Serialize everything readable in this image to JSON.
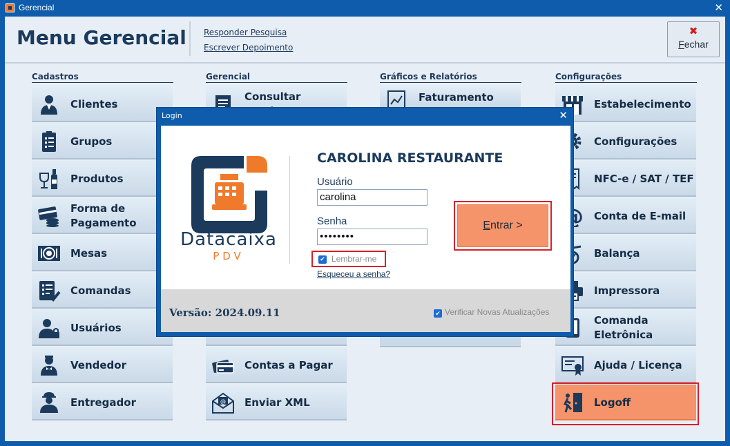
{
  "window": {
    "title": "Gerencial",
    "close_glyph": "✕"
  },
  "header": {
    "title": "Menu Gerencial",
    "links": [
      "Responder Pesquisa",
      "Escrever Depoimento"
    ],
    "close_button": {
      "icon": "close-x-icon",
      "label_first": "F",
      "label_rest": "echar"
    }
  },
  "columns": [
    {
      "title": "Cadastros",
      "items": [
        {
          "label": "Clientes",
          "icon": "person-icon"
        },
        {
          "label": "Grupos",
          "icon": "clipboard-list-icon"
        },
        {
          "label": "Produtos",
          "icon": "wine-bottle-icon"
        },
        {
          "label": "Forma de Pagamento",
          "icon": "card-coins-icon"
        },
        {
          "label": "Mesas",
          "icon": "plate-cutlery-icon"
        },
        {
          "label": "Comandas",
          "icon": "checklist-icon"
        },
        {
          "label": "Usuários",
          "icon": "user-lock-icon"
        },
        {
          "label": "Vendedor",
          "icon": "waiter-icon"
        },
        {
          "label": "Entregador",
          "icon": "delivery-person-icon"
        }
      ]
    },
    {
      "title": "Gerencial",
      "items": [
        {
          "label": "Consultar Vendas",
          "icon": "document-icon"
        },
        {
          "label": "Contas a Pagar",
          "icon": "credit-cards-icon"
        },
        {
          "label": "Enviar XML",
          "icon": "envelope-icon"
        }
      ]
    },
    {
      "title": "Gráficos e Relatórios",
      "items": [
        {
          "label": "Faturamento",
          "icon": "report-chart-icon"
        }
      ]
    },
    {
      "title": "Configurações",
      "items": [
        {
          "label": "Estabelecimento",
          "icon": "storefront-icon"
        },
        {
          "label": "Configurações",
          "icon": "gear-icon"
        },
        {
          "label": "NFC-e / SAT / TEF",
          "icon": "receipt-icon"
        },
        {
          "label": "Conta de E-mail",
          "icon": "at-sign-icon"
        },
        {
          "label": "Balança",
          "icon": "scale-icon"
        },
        {
          "label": "Impressora",
          "icon": "printer-icon"
        },
        {
          "label": "Comanda Eletrônica",
          "icon": "tablet-icon"
        },
        {
          "label": "Ajuda / Licença",
          "icon": "certificate-icon"
        },
        {
          "label": "Logoff",
          "icon": "exit-door-icon"
        }
      ]
    }
  ],
  "login": {
    "title": "Login",
    "close_glyph": "✕",
    "brand": "Datacaixa",
    "brand_sub": "PDV",
    "company": "CAROLINA RESTAURANTE",
    "user_label": "Usuário",
    "user_value": "carolina",
    "password_label": "Senha",
    "password_value": "••••••••",
    "remember_label": "Lembrar-me",
    "remember_checked": true,
    "forgot_label": "Esqueceu a senha?",
    "enter_first": "E",
    "enter_rest": "ntrar >",
    "version": "Versão: 2024.09.11",
    "check_updates_label": "Verificar Novas Atualizações",
    "check_updates_checked": true
  },
  "colors": {
    "titlebar": "#0e5cab",
    "navy": "#1b3a5c",
    "accent_orange": "#f5936a",
    "brand_orange": "#f07a2c",
    "highlight_red": "#d7202a",
    "button_bg": "#d7e4f0"
  }
}
